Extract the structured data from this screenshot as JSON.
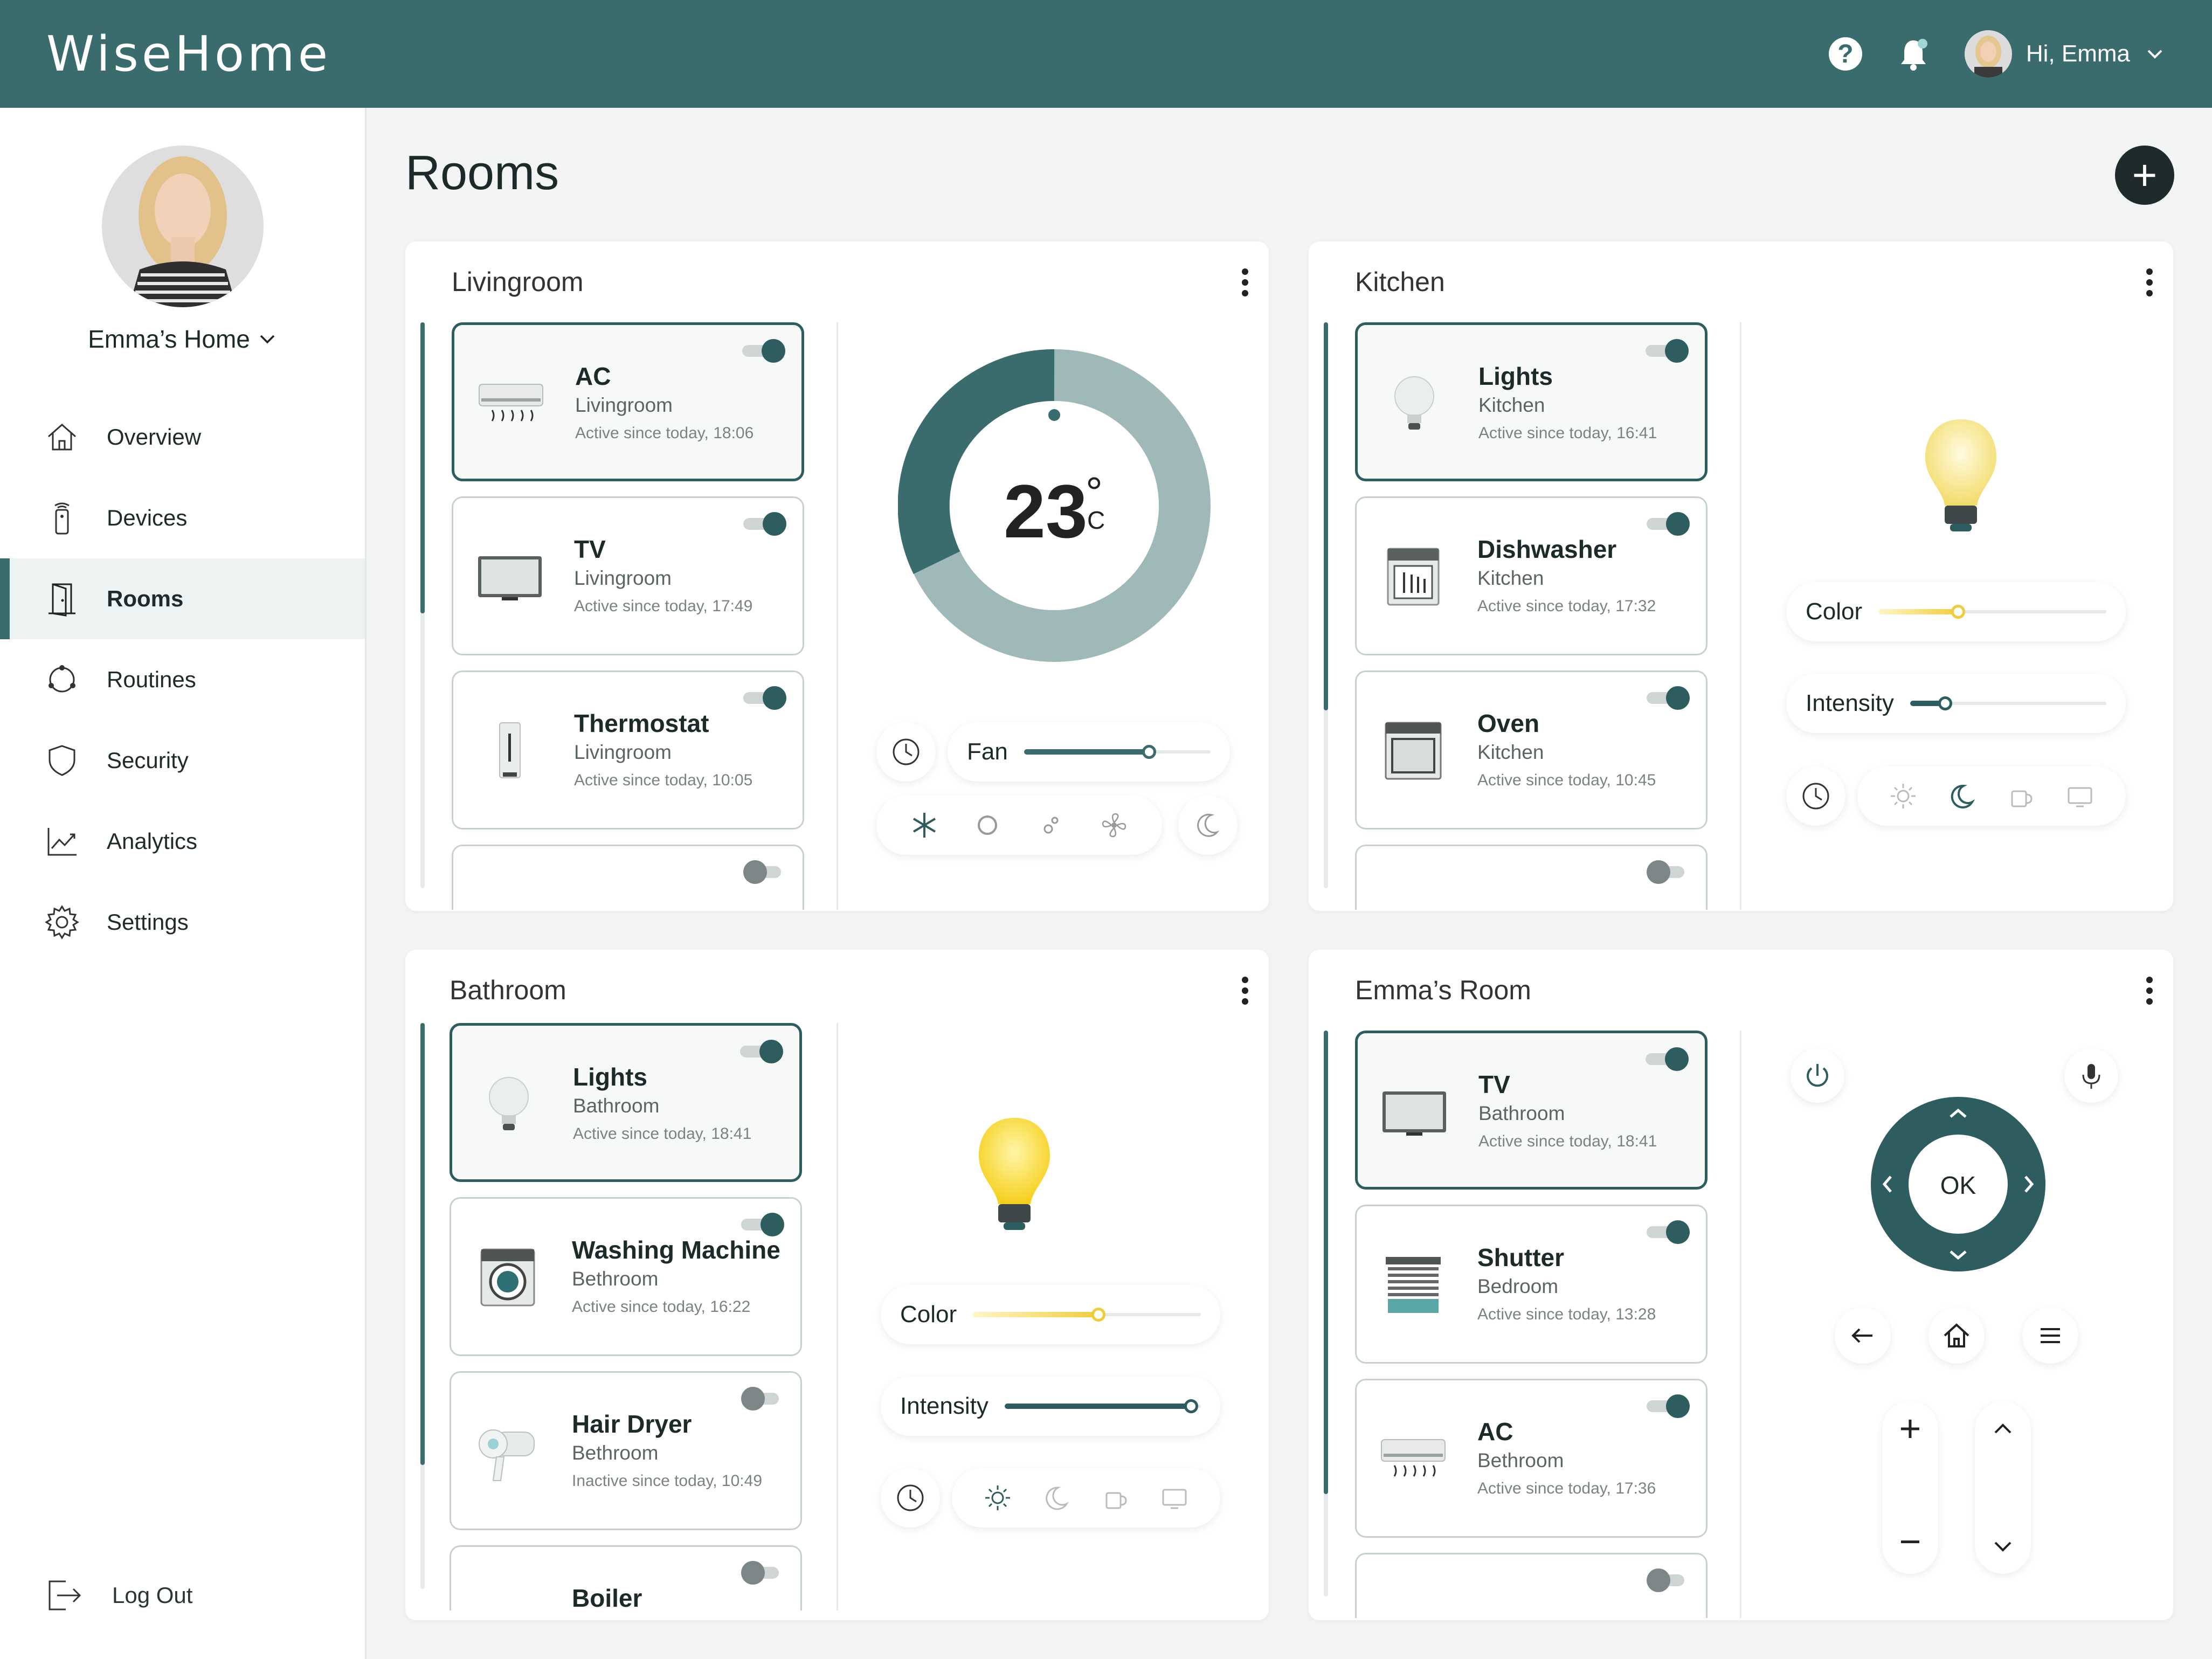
{
  "app": {
    "logo": "WiseHome"
  },
  "header": {
    "greeting": "Hi, Emma",
    "icons": [
      "help-icon",
      "bell-icon",
      "chevron-down-icon"
    ]
  },
  "sidebar": {
    "home_name": "Emma’s Home",
    "items": [
      {
        "label": "Overview",
        "icon": "house-icon"
      },
      {
        "label": "Devices",
        "icon": "remote-icon"
      },
      {
        "label": "Rooms",
        "icon": "door-icon",
        "active": true
      },
      {
        "label": "Routines",
        "icon": "routine-icon"
      },
      {
        "label": "Security",
        "icon": "shield-icon"
      },
      {
        "label": "Analytics",
        "icon": "chart-icon"
      },
      {
        "label": "Settings",
        "icon": "gear-icon"
      }
    ],
    "logout": "Log Out"
  },
  "page": {
    "title": "Rooms"
  },
  "colors": {
    "primary": "#3a6b6d",
    "dark": "#1f2a2a",
    "bulb": "#f6d33c",
    "ring_light": "#9fb8b8"
  },
  "rooms": {
    "livingroom": {
      "title": "Livingroom",
      "devices": [
        {
          "name": "AC",
          "room": "Livingroom",
          "status": "Active since today, 18:06",
          "on": true
        },
        {
          "name": "TV",
          "room": "Livingroom",
          "status": "Active since today, 17:49",
          "on": true
        },
        {
          "name": "Thermostat",
          "room": "Livingroom",
          "status": "Active since today, 10:05",
          "on": true
        }
      ],
      "temperature": "23",
      "temp_unit_deg": "°",
      "temp_unit": "C",
      "fan_label": "Fan",
      "fan_level": 0.67
    },
    "kitchen": {
      "title": "Kitchen",
      "devices": [
        {
          "name": "Lights",
          "room": "Kitchen",
          "status": "Active since today, 16:41",
          "on": true
        },
        {
          "name": "Dishwasher",
          "room": "Kitchen",
          "status": "Active since today, 17:32",
          "on": true
        },
        {
          "name": "Oven",
          "room": "Kitchen",
          "status": "Active since today, 10:45",
          "on": true
        }
      ],
      "color_label": "Color",
      "intensity_label": "Intensity",
      "color_level": 0.35,
      "intensity_level": 0.18
    },
    "bathroom": {
      "title": "Bathroom",
      "devices": [
        {
          "name": "Lights",
          "room": "Bathroom",
          "status": "Active since today, 18:41",
          "on": true
        },
        {
          "name": "Washing Machine",
          "room": "Bethroom",
          "status": "Active since today, 16:22",
          "on": true
        },
        {
          "name": "Hair Dryer",
          "room": "Bethroom",
          "status": "Inactive since today, 10:49",
          "on": false
        },
        {
          "name": "Boiler",
          "room": "",
          "status": "",
          "on": false
        }
      ],
      "color_label": "Color",
      "intensity_label": "Intensity",
      "color_level": 0.55,
      "intensity_level": 0.95
    },
    "emmas_room": {
      "title": "Emma’s Room",
      "devices": [
        {
          "name": "TV",
          "room": "Bathroom",
          "status": "Active since today, 18:41",
          "on": true
        },
        {
          "name": "Shutter",
          "room": "Bedroom",
          "status": "Active since today, 13:28",
          "on": true
        },
        {
          "name": "AC",
          "room": "Bethroom",
          "status": "Active since today, 17:36",
          "on": true
        }
      ],
      "remote_ok": "OK",
      "vol_plus": "+",
      "vol_minus": "−"
    }
  }
}
